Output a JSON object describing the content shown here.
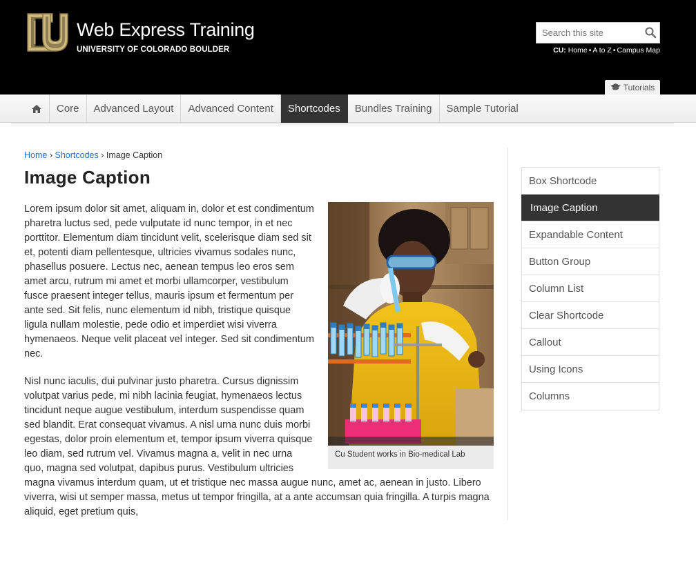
{
  "header": {
    "site_title": "Web Express Training",
    "univ_prefix": "UNIVERSITY OF COLORADO",
    "univ_bold": "BOULDER",
    "search_placeholder": "Search this site",
    "cu_label": "CU:",
    "cu_links": [
      "Home",
      "A to Z",
      "Campus Map"
    ],
    "tutorials_label": "Tutorials",
    "brand_gold": "#CFB87C",
    "icons": {
      "logo": "cu-logo-icon",
      "search": "search-icon",
      "tutorials": "graduation-cap-icon"
    }
  },
  "nav": {
    "home_icon": "home-icon",
    "items": [
      "Core",
      "Advanced Layout",
      "Advanced Content",
      "Shortcodes",
      "Bundles Training",
      "Sample Tutorial"
    ],
    "active": "Shortcodes",
    "active_bg": "#333333"
  },
  "breadcrumb": {
    "home": "Home",
    "section": "Shortcodes",
    "current": "Image Caption",
    "separator": "›"
  },
  "page": {
    "title": "Image Caption",
    "paragraphs": [
      "Lorem ipsum dolor sit amet, aliquam in, dolor et est condimentum pharetra luctus sed, pede vulputate id nunc tempor, in et nec porttitor. Elementum diam tincidunt velit, scelerisque diam sed sit et, potenti diam pellentesque, ultricies vivamus sodales nunc, phasellus posuere. Lectus nec, aenean tempus leo eros sem amet arcu, rutrum mi amet et morbi ullamcorper, vestibulum fusce praesent integer tellus, mauris ipsum et fermentum per ante sed. Sit felis, nunc elementum id nibh, tristique quisque ligula nullam molestie, pede odio et imperdiet wisi viverra hymenaeos. Neque velit placeat vel integer. Sed sit condimentum nec.",
      "Nisl nunc iaculis, dui pulvinar justo pharetra. Cursus dignissim volutpat varius pede, mi nibh lacinia feugiat, hymenaeos lectus tincidunt neque augue vestibulum, interdum suspendisse quam sed blandit. Erat consequat vivamus. A nisl urna nunc duis morbi egestas, dolor proin elementum et, tempor ipsum viverra quisque leo diam, sed rutrum vel. Vivamus magna a, velit in nec urna quo, magna sed volutpat, dapibus purus. Vestibulum ultricies magna vivamus interdum quam, ut et tristique nec massa augue nunc, amet ac, aenean in justo. Libero viverra, wisi ut semper massa, metus ut tempor fringilla, at a ante accumsan quia fringilla. A turpis magna aliquid, eget pretium quis,"
    ],
    "image_caption": "Cu Student works in Bio-medical Lab"
  },
  "sidebar": {
    "items": [
      "Box Shortcode",
      "Image Caption",
      "Expandable Content",
      "Button Group",
      "Column List",
      "Clear Shortcode",
      "Callout",
      "Using Icons",
      "Columns"
    ],
    "active": "Image Caption"
  }
}
